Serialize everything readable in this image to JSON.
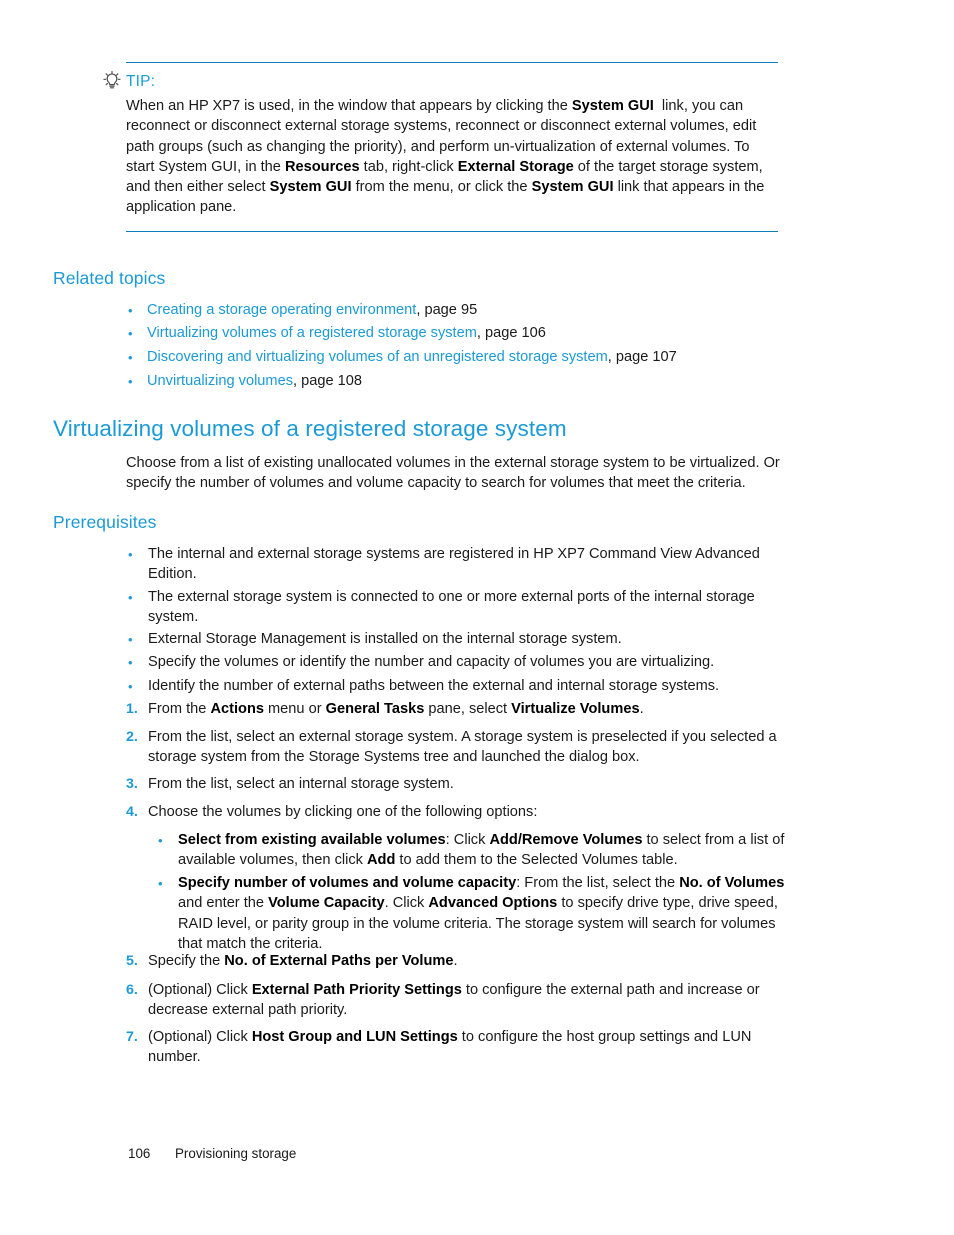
{
  "tip": {
    "icon": "lightbulb-icon",
    "label": "TIP:",
    "body_html": "When an HP XP7 is used, in the window that appears by clicking the <b>System GUI</b>&nbsp; link, you can reconnect or disconnect external storage systems, reconnect or disconnect external volumes, edit path groups (such as changing the priority), and perform un-virtualization of external volumes. To start System GUI, in the <b>Resources</b> tab, right-click <b>External Storage</b> of the target storage system, and then either select <b>System GUI</b> from the menu, or click the <b>System GUI</b> link that appears in the application pane."
  },
  "related_topics": {
    "heading": "Related topics",
    "items": [
      {
        "link": "Creating a storage operating environment",
        "page_label": ", page 95"
      },
      {
        "link": "Virtualizing volumes of a registered storage system",
        "page_label": ", page 106"
      },
      {
        "link": "Discovering and virtualizing volumes of an unregistered storage system",
        "page_label": ", page 107"
      },
      {
        "link": "Unvirtualizing volumes",
        "page_label": ", page 108"
      }
    ]
  },
  "section": {
    "title": "Virtualizing volumes of a registered storage system",
    "intro": "Choose from a list of existing unallocated volumes in the external storage system to be virtualized. Or specify the number of volumes and volume capacity to search for volumes that meet the criteria."
  },
  "prerequisites": {
    "heading": "Prerequisites",
    "bullets": [
      "The internal and external storage systems are registered in HP XP7 Command View Advanced Edition.",
      "The external storage system is connected to one or more external ports of the internal storage system.",
      "External Storage Management is installed on the internal storage system.",
      "Specify the volumes or identify the number and capacity of volumes you are virtualizing.",
      "Identify the number of external paths between the external and internal storage systems."
    ]
  },
  "steps": [
    {
      "number": "1.",
      "html": "From the <b>Actions</b> menu or <b>General Tasks</b> pane, select <b>Virtualize Volumes</b>."
    },
    {
      "number": "2.",
      "html": "From the list, select an external storage system. A storage system is preselected if you selected a storage system from the Storage Systems tree and launched the dialog box."
    },
    {
      "number": "3.",
      "html": "From the list, select an internal storage system."
    },
    {
      "number": "4.",
      "html": "Choose the volumes by clicking one of the following options:",
      "substeps": [
        "<b>Select from existing available volumes</b>: Click <b>Add/Remove Volumes</b> to select from a list of available volumes, then click <b>Add</b> to add them to the Selected Volumes table.",
        "<b>Specify number of volumes and volume capacity</b>: From the list, select the <b>No. of Volumes</b> and enter the <b>Volume Capacity</b>. Click <b>Advanced Options</b> to specify drive type, drive speed, RAID level, or parity group in the volume criteria. The storage system will search for volumes that match the criteria."
      ]
    },
    {
      "number": "5.",
      "html": "Specify the <b>No. of External Paths per Volume</b>."
    },
    {
      "number": "6.",
      "html": "(Optional) Click <b>External Path Priority Settings</b> to configure the external path and increase or decrease external path priority."
    },
    {
      "number": "7.",
      "html": "(Optional) Click <b>Host Group and LUN Settings</b> to configure the host group settings and LUN number."
    }
  ],
  "footer": {
    "page_number": "106",
    "section_name": "Provisioning storage"
  },
  "colors": {
    "accent_blue": "#1b9ad6",
    "rule_blue": "#0f7dbd",
    "text": "#1a1a1a"
  }
}
